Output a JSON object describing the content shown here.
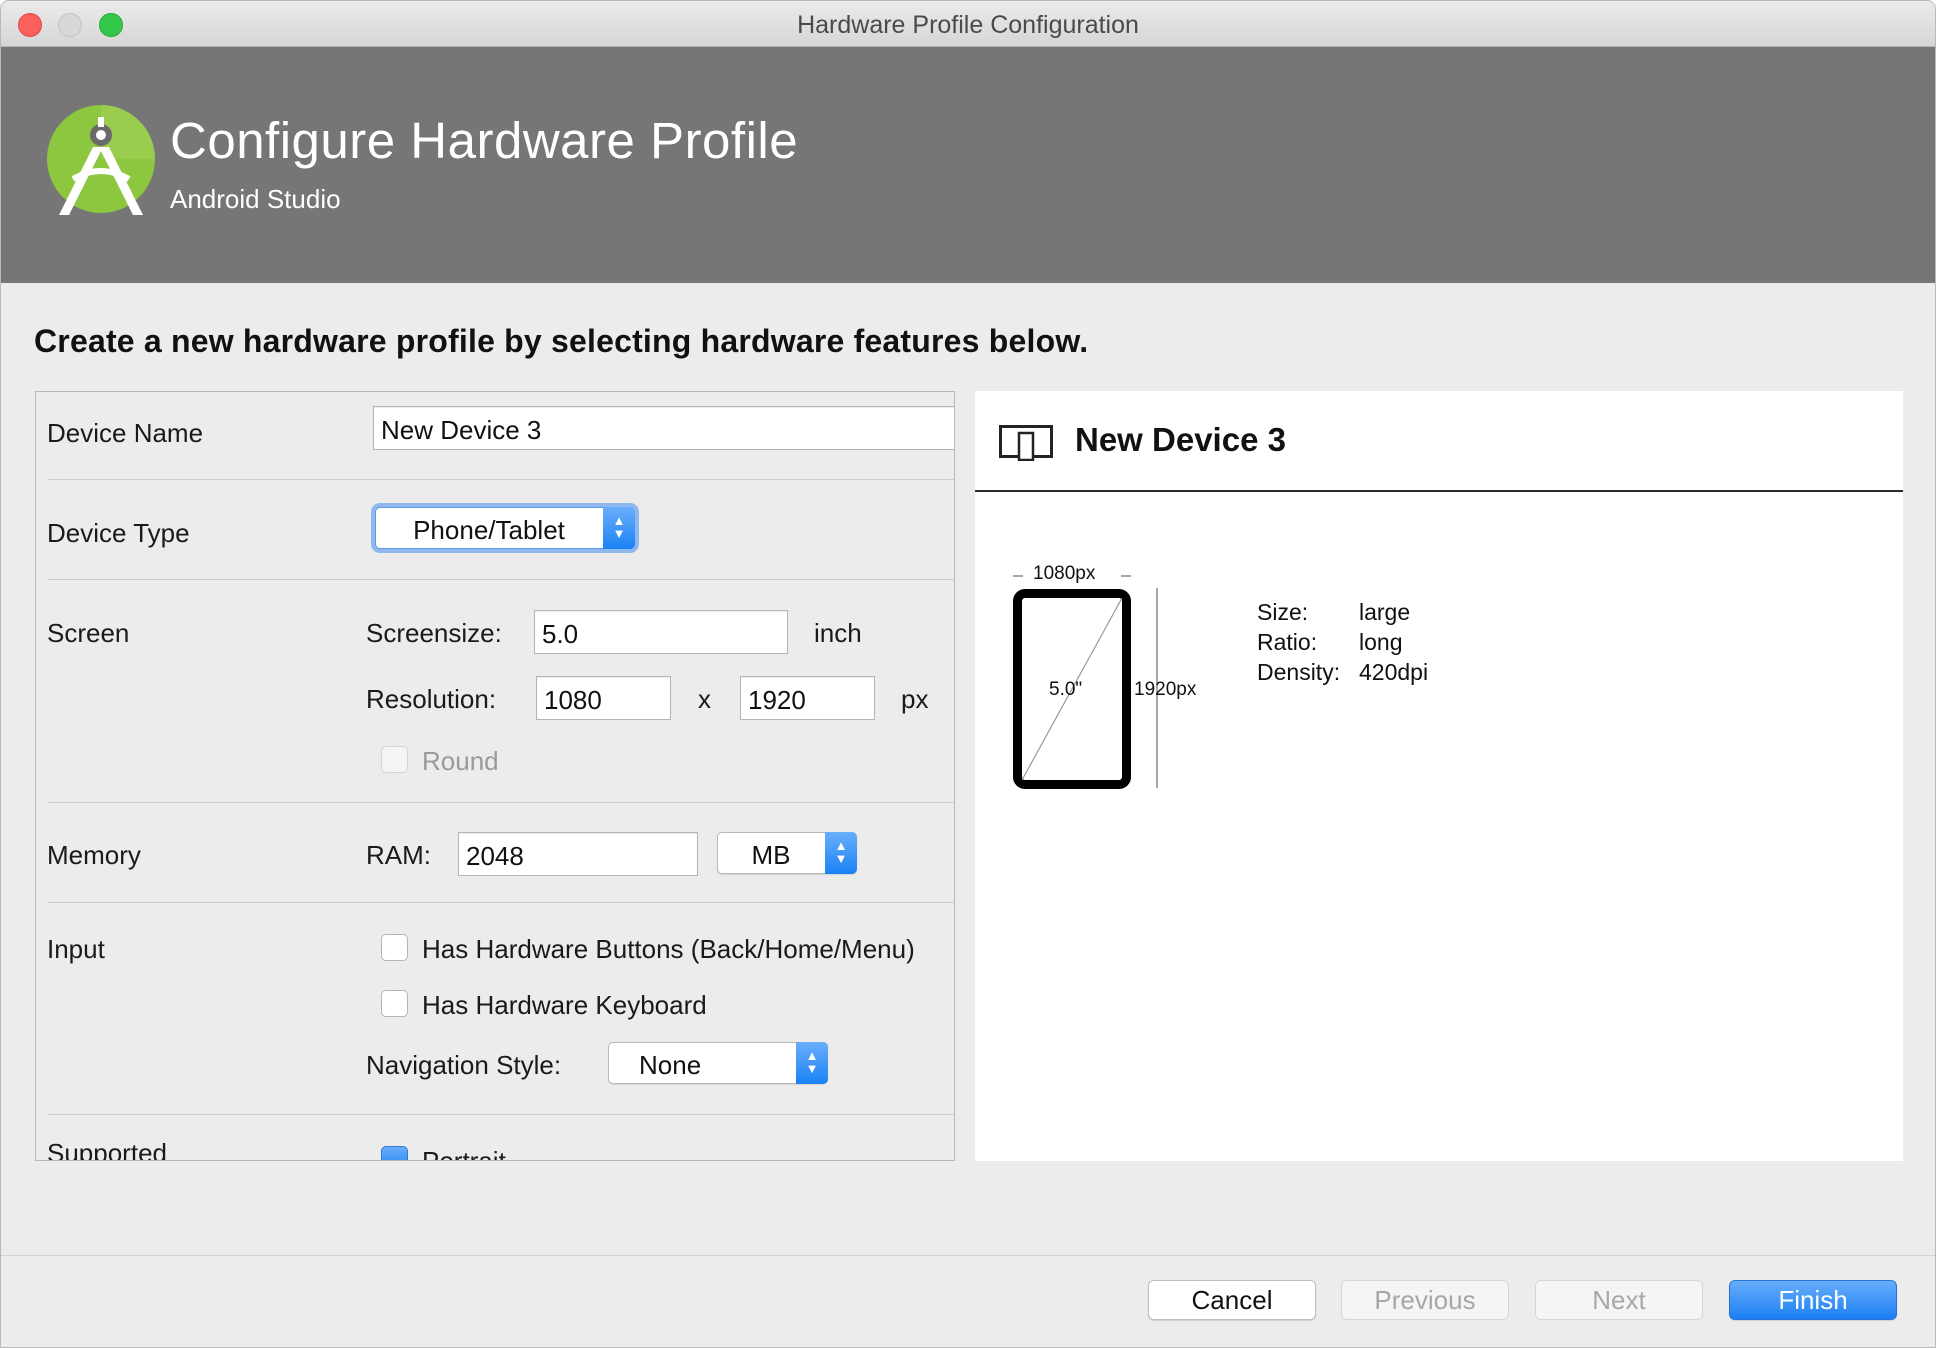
{
  "window": {
    "title": "Hardware Profile Configuration"
  },
  "header": {
    "title": "Configure Hardware Profile",
    "subtitle": "Android Studio"
  },
  "instruction": "Create a new hardware profile by selecting hardware features below.",
  "form": {
    "device_name": {
      "label": "Device Name",
      "value": "New Device 3"
    },
    "device_type": {
      "label": "Device Type",
      "value": "Phone/Tablet"
    },
    "screen": {
      "label": "Screen",
      "screensize_label": "Screensize:",
      "screensize_value": "5.0",
      "screensize_unit": "inch",
      "resolution_label": "Resolution:",
      "res_width": "1080",
      "res_x": "x",
      "res_height": "1920",
      "res_unit": "px",
      "round_label": "Round"
    },
    "memory": {
      "label": "Memory",
      "ram_label": "RAM:",
      "ram_value": "2048",
      "ram_unit": "MB"
    },
    "input": {
      "label": "Input",
      "hw_buttons_label": "Has Hardware Buttons (Back/Home/Menu)",
      "hw_keyboard_label": "Has Hardware Keyboard",
      "nav_style_label": "Navigation Style:",
      "nav_style_value": "None"
    },
    "supported": {
      "label": "Supported",
      "portrait_label": "Portrait"
    }
  },
  "preview": {
    "title": "New Device 3",
    "width_px": "1080px",
    "height_px": "1920px",
    "diagonal": "5.0\"",
    "size_label": "Size:",
    "size_value": "large",
    "ratio_label": "Ratio:",
    "ratio_value": "long",
    "density_label": "Density:",
    "density_value": "420dpi"
  },
  "buttons": {
    "cancel": "Cancel",
    "previous": "Previous",
    "next": "Next",
    "finish": "Finish"
  },
  "colors": {
    "banner": "#767676",
    "accent_blue": "#1a82f5",
    "android_green": "#a4c639"
  }
}
